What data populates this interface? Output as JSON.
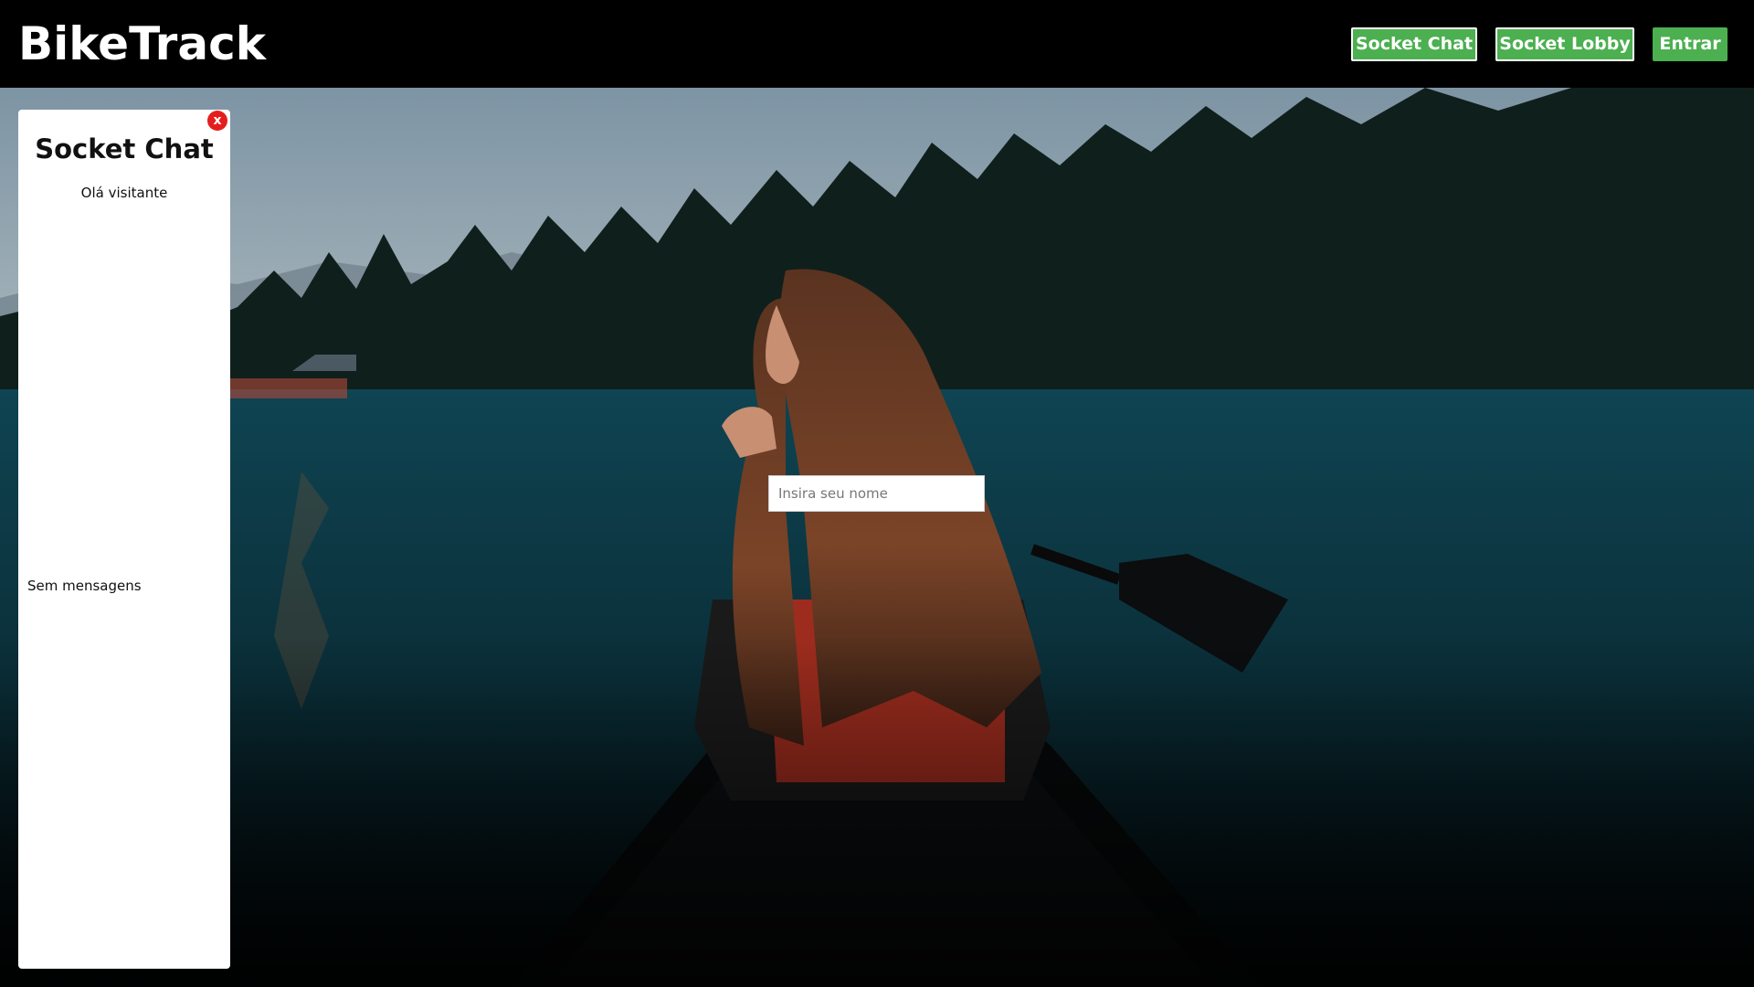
{
  "header": {
    "brand": "BikeTrack",
    "buttons": {
      "socket_chat": "Socket Chat",
      "socket_lobby": "Socket Lobby",
      "enter": "Entrar"
    }
  },
  "chat": {
    "title": "Socket Chat",
    "greeting": "Olá visitante",
    "empty_state": "Sem mensagens",
    "close_label": "x"
  },
  "name_input": {
    "value": "",
    "placeholder": "Insira seu nome"
  },
  "background": {
    "description_icon": "lake-canoe-photo"
  },
  "colors": {
    "header_bg": "#000000",
    "button_green": "#4caf50",
    "close_red": "#e41e1e",
    "panel_bg": "#ffffff"
  }
}
